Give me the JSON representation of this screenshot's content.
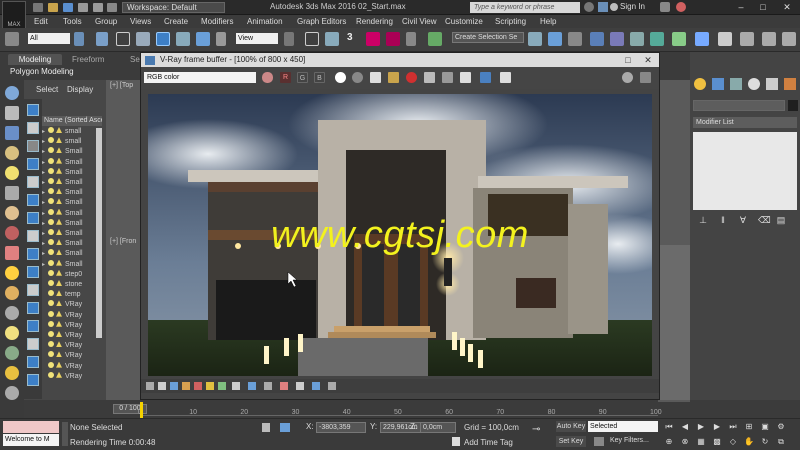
{
  "titlebar": {
    "app_logo": "MAX",
    "workspace": "Workspace: Default",
    "title": "Autodesk 3ds Max 2016     02_Start.max",
    "search_placeholder": "Type a keyword or phrase",
    "signin": "Sign In"
  },
  "menu": [
    "Edit",
    "Tools",
    "Group",
    "Views",
    "Create",
    "Modifiers",
    "Animation",
    "Graph Editors",
    "Rendering",
    "Civil View",
    "Customize",
    "Scripting",
    "Help"
  ],
  "toolbar": {
    "selection_filter": "All",
    "reference_coord": "View",
    "create_selection_set": "Create Selection Se",
    "snap_label": "3"
  },
  "ribbon": {
    "tabs": [
      "Modeling",
      "Freeform",
      "Se"
    ],
    "sub_label": "Polygon Modeling"
  },
  "explorer": {
    "menu_select": "Select",
    "menu_display": "Display",
    "column_header": "Name (Sorted Ascen",
    "rows": [
      "small",
      "small",
      "Small",
      "Small",
      "Small",
      "Small",
      "Small",
      "Small",
      "Small",
      "Small",
      "Small",
      "Small",
      "Small",
      "Small",
      "step0",
      "stone",
      "temp",
      "VRay",
      "VRay",
      "VRay",
      "VRay",
      "VRay",
      "VRay",
      "VRay",
      "VRay"
    ]
  },
  "viewports": {
    "top_label": "[+] [Top",
    "front_label": "[+] [Fron"
  },
  "vfb": {
    "title": "V-Ray frame buffer - [100% of 800 x 450]",
    "channel": "RGB color",
    "btn_r": "R",
    "btn_g": "G",
    "btn_b": "B",
    "watermark": "www.cgtsj.com"
  },
  "command_panel": {
    "modifier_list": "Modifier List"
  },
  "timeline": {
    "slider": "0 / 100",
    "ticks": [
      "0",
      "10",
      "20",
      "30",
      "40",
      "50",
      "60",
      "70",
      "80",
      "90",
      "100"
    ]
  },
  "status": {
    "maxscript": "Welcome to M",
    "selection": "None Selected",
    "render_time": "Rendering Time  0:00:48",
    "x_label": "X:",
    "x_value": "-3803,359",
    "y_label": "Y:",
    "y_value": "229,961cm",
    "z_label": "Z:",
    "z_value": "0,0cm",
    "grid": "Grid = 100,0cm",
    "add_time_tag": "Add Time Tag",
    "auto_key": "Auto Key",
    "set_key": "Set Key",
    "key_mode": "Selected",
    "key_filters": "Key Filters..."
  },
  "colors": {
    "accent_blue": "#3d7fc6",
    "watermark_yellow": "#f3f21e",
    "cursor_yellow": "#f5d200"
  }
}
